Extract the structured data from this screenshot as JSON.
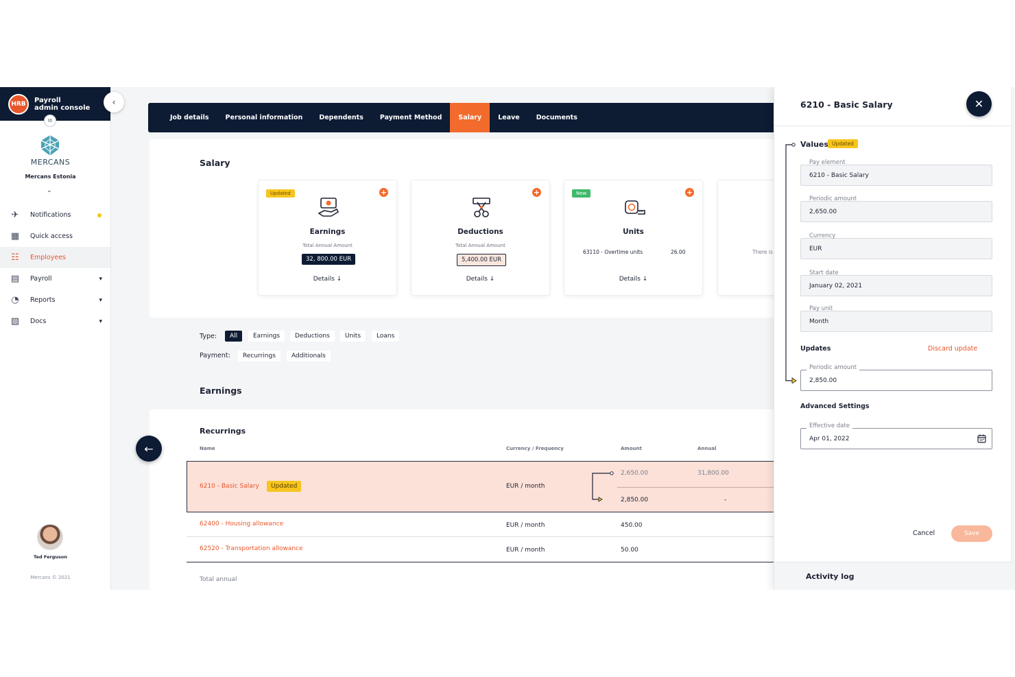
{
  "sidebar": {
    "logo_text": "HRB",
    "title_line1": "Payroll",
    "title_line2": "admin console",
    "company_badge": "III",
    "brand_word": "MERCANS",
    "company_name": "Mercans Estonia",
    "nav": [
      {
        "label": "Notifications",
        "icon": "rocket-icon"
      },
      {
        "label": "Quick access",
        "icon": "grid-icon"
      },
      {
        "label": "Employees",
        "icon": "employees-icon",
        "active": true
      },
      {
        "label": "Payroll",
        "icon": "payroll-icon"
      },
      {
        "label": "Reports",
        "icon": "reports-icon"
      },
      {
        "label": "Docs",
        "icon": "docs-icon"
      }
    ],
    "user_name": "Ted Ferguson",
    "copyright": "Mercans © 2021"
  },
  "tabs": [
    "Job details",
    "Personal information",
    "Dependents",
    "Payment Method",
    "Salary",
    "Leave",
    "Documents"
  ],
  "active_tab": "Salary",
  "salary": {
    "title": "Salary",
    "cards": [
      {
        "badge": "Updated",
        "title": "Earnings",
        "subtitle": "Total Annual Amount",
        "amount": "32, 800.00 EUR",
        "details": "Details ↓"
      },
      {
        "title": "Deductions",
        "subtitle": "Total Annual Amount",
        "amount": "5,400.00 EUR",
        "details": "Details ↓"
      },
      {
        "badge": "New",
        "title": "Units",
        "unit_name": "63110 - Overtime units",
        "unit_value": "26.00",
        "details": "Details ↓"
      },
      {
        "partial_text": "There is"
      }
    ]
  },
  "filters": {
    "type_label": "Type:",
    "type_options": [
      "All",
      "Earnings",
      "Deductions",
      "Units",
      "Loans"
    ],
    "payment_label": "Payment:",
    "payment_options": [
      "Recurrings",
      "Additionals"
    ]
  },
  "earnings": {
    "title": "Earnings",
    "recurrings_title": "Recurrings",
    "columns": [
      "Name",
      "Currency / Frequency",
      "Amount",
      "Annual"
    ],
    "rows": [
      {
        "name": "6210 - Basic Salary",
        "tag": "Updated",
        "freq": "EUR / month",
        "old_amount": "2,650.00",
        "old_annual": "31,800.00",
        "new_amount": "2,850.00",
        "new_annual": "-"
      },
      {
        "name": "62400 - Housing allowance",
        "freq": "EUR / month",
        "amount": "450.00"
      },
      {
        "name": "62520 - Transportation allowance",
        "freq": "EUR / month",
        "amount": "50.00"
      }
    ],
    "total_label": "Total annual"
  },
  "panel": {
    "title": "6210 - Basic Salary",
    "values_label": "Values",
    "values_badge": "Updated",
    "fields": [
      {
        "label": "Pay element",
        "value": "6210 - Basic Salary"
      },
      {
        "label": "Periodic amount",
        "value": "2,650.00"
      },
      {
        "label": "Currency",
        "value": "EUR"
      },
      {
        "label": "Start date",
        "value": "January 02, 2021"
      },
      {
        "label": "Pay unit",
        "value": "Month"
      }
    ],
    "updates_label": "Updates",
    "discard_label": "Discard update",
    "update_field": {
      "label": "Periodic amount",
      "value": "2,850.00"
    },
    "advanced_label": "Advanced Settings",
    "effective_field": {
      "label": "Effective date",
      "value": "Apr 01, 2022"
    },
    "cancel_label": "Cancel",
    "save_label": "Save",
    "activity_label": "Activity log"
  },
  "colors": {
    "navy": "#0d1b33",
    "accent": "#f26b2c",
    "badge_yellow": "#f7c51d",
    "badge_green": "#3fb96b"
  }
}
